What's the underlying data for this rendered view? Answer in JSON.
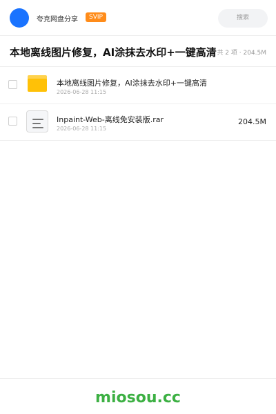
{
  "header": {
    "username": "夸克网盘分享",
    "badge": "SVIP",
    "search_placeholder": "搜索"
  },
  "share": {
    "title": "本地离线图片修复，AI涂抹去水印+一键高清",
    "meta": "共 2 项 · 204.5M"
  },
  "files": [
    {
      "name": "本地离线图片修复，AI涂抹去水印+一键高清",
      "date": "2026-06-28 11:15",
      "size": "",
      "icon": "folder-icon"
    },
    {
      "name": "Inpaint-Web-离线免安装版.rar",
      "date": "2026-06-28 11:15",
      "size": "204.5M",
      "icon": "archive-file-icon"
    }
  ],
  "footer": {
    "watermark": "miosou.cc"
  },
  "colors": {
    "avatar": "#1a73ff",
    "badge": "#ff8c1a",
    "folder": "#ffc107",
    "watermark": "#3cb043"
  }
}
